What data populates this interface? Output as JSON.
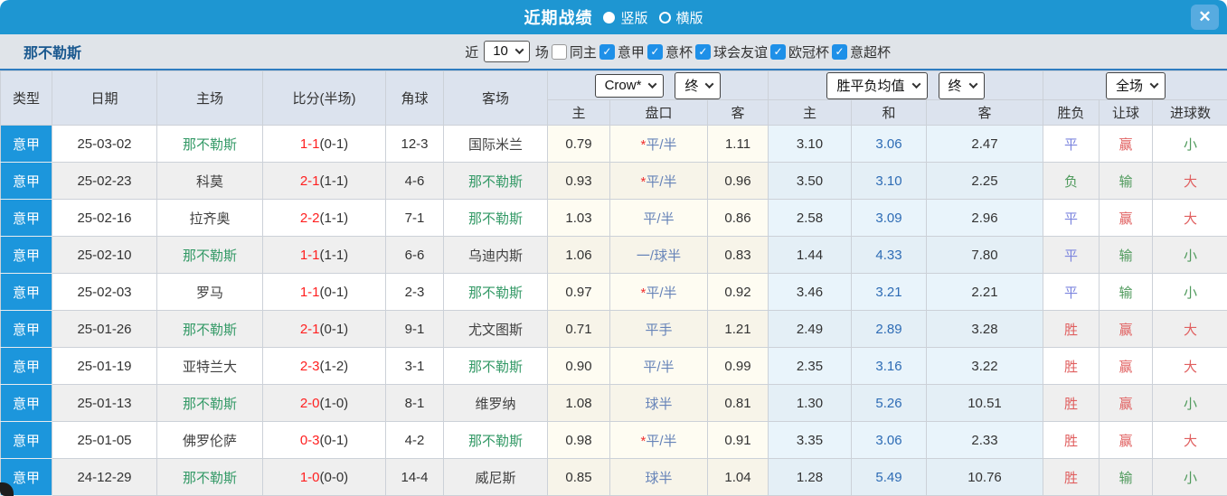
{
  "titlebar": {
    "title": "近期战绩",
    "vertical_label": "竖版",
    "horizontal_label": "横版",
    "vertical_selected": true,
    "close_label": "✕",
    "bar_color": "#1e96d2"
  },
  "filterbar": {
    "team": "那不勒斯",
    "recent_label": "近",
    "recent_value": "10",
    "matches_label": "场",
    "same_home_label": "同主",
    "same_home_checked": false,
    "leagues": [
      {
        "label": "意甲",
        "checked": true
      },
      {
        "label": "意杯",
        "checked": true
      },
      {
        "label": "球会友谊",
        "checked": true
      },
      {
        "label": "欧冠杯",
        "checked": true
      },
      {
        "label": "意超杯",
        "checked": true
      }
    ]
  },
  "table": {
    "headers": [
      "类型",
      "日期",
      "主场",
      "比分(半场)",
      "角球",
      "客场"
    ],
    "groups": {
      "crow_select": "Crow*",
      "crow_period_select": "终",
      "avg_select": "胜平负均值",
      "avg_period_select": "终",
      "fulltime_select": "全场"
    },
    "sub_headers": [
      "主",
      "盘口",
      "客",
      "主",
      "和",
      "客",
      "胜负",
      "让球",
      "进球数"
    ],
    "accent_colors": {
      "focus_team": "#339966",
      "score_red": "#ff2020",
      "handicap_blue": "#6683b8",
      "avg_draw_blue": "#2e6cb5",
      "win_red": "#e05f5f",
      "draw_blue": "#7b84de",
      "lose_green": "#4f9a5c"
    },
    "rows": [
      {
        "league": "意甲",
        "date": "25-03-02",
        "home": "那不勒斯",
        "home_focus": true,
        "score": "1-1",
        "half": "(0-1)",
        "corner": "12-3",
        "away": "国际米兰",
        "away_focus": false,
        "odds_home": "0.79",
        "handicap": "平/半",
        "star": true,
        "odds_away": "1.11",
        "avg_win": "3.10",
        "avg_draw": "3.06",
        "avg_lose": "2.47",
        "result": "平",
        "result_c": "blue",
        "let_ball": "赢",
        "let_c": "red",
        "goals": "小",
        "goals_c": "green"
      },
      {
        "league": "意甲",
        "date": "25-02-23",
        "home": "科莫",
        "home_focus": false,
        "score": "2-1",
        "half": "(1-1)",
        "corner": "4-6",
        "away": "那不勒斯",
        "away_focus": true,
        "odds_home": "0.93",
        "handicap": "平/半",
        "star": true,
        "odds_away": "0.96",
        "avg_win": "3.50",
        "avg_draw": "3.10",
        "avg_lose": "2.25",
        "result": "负",
        "result_c": "green",
        "let_ball": "输",
        "let_c": "green",
        "goals": "大",
        "goals_c": "red"
      },
      {
        "league": "意甲",
        "date": "25-02-16",
        "home": "拉齐奥",
        "home_focus": false,
        "score": "2-2",
        "half": "(1-1)",
        "corner": "7-1",
        "away": "那不勒斯",
        "away_focus": true,
        "odds_home": "1.03",
        "handicap": "平/半",
        "star": false,
        "odds_away": "0.86",
        "avg_win": "2.58",
        "avg_draw": "3.09",
        "avg_lose": "2.96",
        "result": "平",
        "result_c": "blue",
        "let_ball": "赢",
        "let_c": "red",
        "goals": "大",
        "goals_c": "red"
      },
      {
        "league": "意甲",
        "date": "25-02-10",
        "home": "那不勒斯",
        "home_focus": true,
        "score": "1-1",
        "half": "(1-1)",
        "corner": "6-6",
        "away": "乌迪内斯",
        "away_focus": false,
        "odds_home": "1.06",
        "handicap": "一/球半",
        "star": false,
        "odds_away": "0.83",
        "avg_win": "1.44",
        "avg_draw": "4.33",
        "avg_lose": "7.80",
        "result": "平",
        "result_c": "blue",
        "let_ball": "输",
        "let_c": "green",
        "goals": "小",
        "goals_c": "green"
      },
      {
        "league": "意甲",
        "date": "25-02-03",
        "home": "罗马",
        "home_focus": false,
        "score": "1-1",
        "half": "(0-1)",
        "corner": "2-3",
        "away": "那不勒斯",
        "away_focus": true,
        "odds_home": "0.97",
        "handicap": "平/半",
        "star": true,
        "odds_away": "0.92",
        "avg_win": "3.46",
        "avg_draw": "3.21",
        "avg_lose": "2.21",
        "result": "平",
        "result_c": "blue",
        "let_ball": "输",
        "let_c": "green",
        "goals": "小",
        "goals_c": "green"
      },
      {
        "league": "意甲",
        "date": "25-01-26",
        "home": "那不勒斯",
        "home_focus": true,
        "score": "2-1",
        "half": "(0-1)",
        "corner": "9-1",
        "away": "尤文图斯",
        "away_focus": false,
        "odds_home": "0.71",
        "handicap": "平手",
        "star": false,
        "odds_away": "1.21",
        "avg_win": "2.49",
        "avg_draw": "2.89",
        "avg_lose": "3.28",
        "result": "胜",
        "result_c": "red",
        "let_ball": "赢",
        "let_c": "red",
        "goals": "大",
        "goals_c": "red"
      },
      {
        "league": "意甲",
        "date": "25-01-19",
        "home": "亚特兰大",
        "home_focus": false,
        "score": "2-3",
        "half": "(1-2)",
        "corner": "3-1",
        "away": "那不勒斯",
        "away_focus": true,
        "odds_home": "0.90",
        "handicap": "平/半",
        "star": false,
        "odds_away": "0.99",
        "avg_win": "2.35",
        "avg_draw": "3.16",
        "avg_lose": "3.22",
        "result": "胜",
        "result_c": "red",
        "let_ball": "赢",
        "let_c": "red",
        "goals": "大",
        "goals_c": "red"
      },
      {
        "league": "意甲",
        "date": "25-01-13",
        "home": "那不勒斯",
        "home_focus": true,
        "score": "2-0",
        "half": "(1-0)",
        "corner": "8-1",
        "away": "维罗纳",
        "away_focus": false,
        "odds_home": "1.08",
        "handicap": "球半",
        "star": false,
        "odds_away": "0.81",
        "avg_win": "1.30",
        "avg_draw": "5.26",
        "avg_lose": "10.51",
        "result": "胜",
        "result_c": "red",
        "let_ball": "赢",
        "let_c": "red",
        "goals": "小",
        "goals_c": "green"
      },
      {
        "league": "意甲",
        "date": "25-01-05",
        "home": "佛罗伦萨",
        "home_focus": false,
        "score": "0-3",
        "half": "(0-1)",
        "corner": "4-2",
        "away": "那不勒斯",
        "away_focus": true,
        "odds_home": "0.98",
        "handicap": "平/半",
        "star": true,
        "odds_away": "0.91",
        "avg_win": "3.35",
        "avg_draw": "3.06",
        "avg_lose": "2.33",
        "result": "胜",
        "result_c": "red",
        "let_ball": "赢",
        "let_c": "red",
        "goals": "大",
        "goals_c": "red"
      },
      {
        "league": "意甲",
        "date": "24-12-29",
        "home": "那不勒斯",
        "home_focus": true,
        "score": "1-0",
        "half": "(0-0)",
        "corner": "14-4",
        "away": "威尼斯",
        "away_focus": false,
        "odds_home": "0.85",
        "handicap": "球半",
        "star": false,
        "odds_away": "1.04",
        "avg_win": "1.28",
        "avg_draw": "5.49",
        "avg_lose": "10.76",
        "result": "胜",
        "result_c": "red",
        "let_ball": "输",
        "let_c": "green",
        "goals": "小",
        "goals_c": "green"
      }
    ]
  }
}
